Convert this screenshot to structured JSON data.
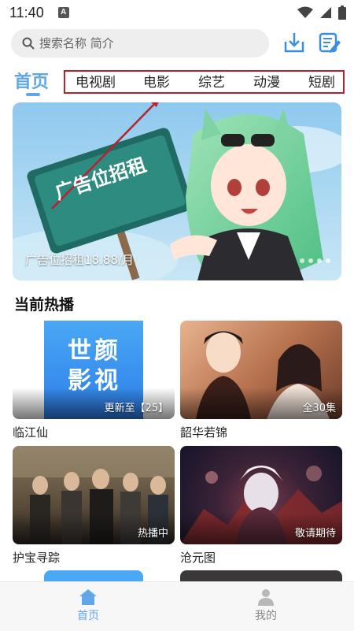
{
  "status_bar": {
    "time": "11:40",
    "notification_icon_label": "A",
    "icons": [
      "wifi-icon",
      "signal-icon",
      "battery-icon"
    ]
  },
  "search": {
    "placeholder": "搜索名称 简介",
    "icons": [
      "search-icon",
      "download-icon",
      "history-notes-icon"
    ]
  },
  "tabs": {
    "active": "首页",
    "items": [
      "电视剧",
      "电影",
      "综艺",
      "动漫",
      "短剧"
    ]
  },
  "banner": {
    "caption": "广告位招租18.88/月",
    "sign_text": "广告位招租"
  },
  "section": {
    "title": "当前热播"
  },
  "cards": [
    {
      "title": "临江仙",
      "badge": "更新至【25】",
      "thumb_text": "世颜影视"
    },
    {
      "title": "韶华若锦",
      "badge": "全30集"
    },
    {
      "title": "护宝寻踪",
      "badge": "热播中"
    },
    {
      "title": "沧元图",
      "badge": "敬请期待"
    }
  ],
  "bottom_nav": {
    "items": [
      {
        "label": "首页",
        "icon": "home-icon",
        "active": true
      },
      {
        "label": "我的",
        "icon": "user-icon",
        "active": false
      }
    ]
  },
  "colors": {
    "accent": "#5fa7e6",
    "highlight_box": "#b4232e",
    "search_bg": "#eeeeee"
  }
}
